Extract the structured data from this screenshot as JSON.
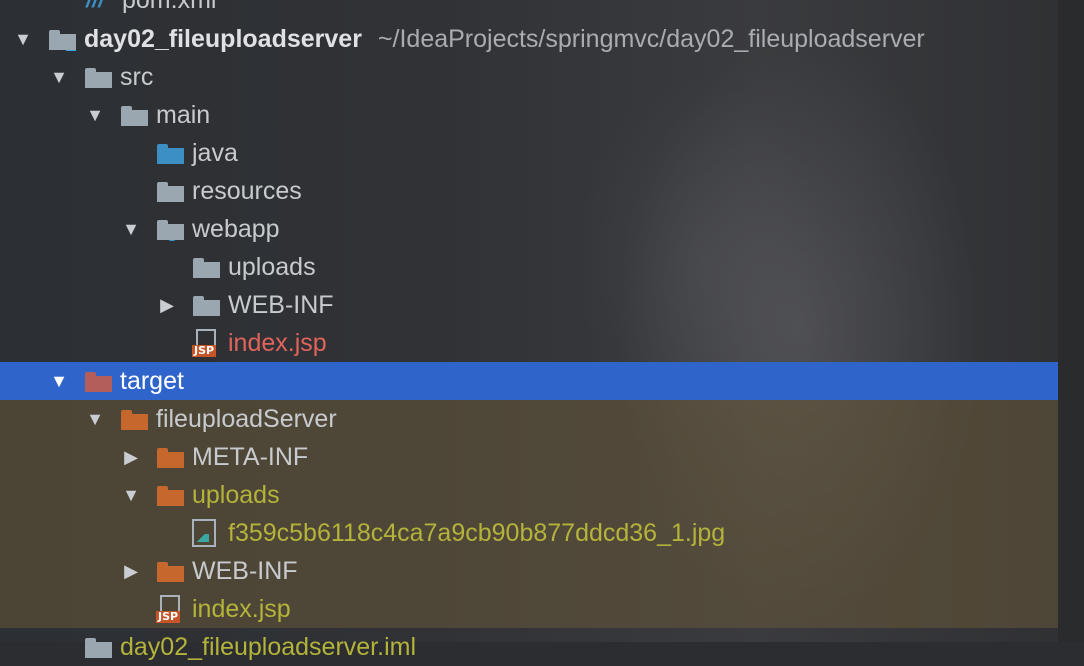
{
  "tree": {
    "rows": [
      {
        "label": "pom.xml",
        "path": "",
        "color": "c-normal"
      },
      {
        "label": "day02_fileuploadserver",
        "path": "~/IdeaProjects/springmvc/day02_fileuploadserver"
      },
      {
        "label": "src"
      },
      {
        "label": "main"
      },
      {
        "label": "java"
      },
      {
        "label": "resources"
      },
      {
        "label": "webapp"
      },
      {
        "label": "uploads"
      },
      {
        "label": "WEB-INF"
      },
      {
        "label": "index.jsp"
      },
      {
        "label": "target"
      },
      {
        "label": "fileuploadServer"
      },
      {
        "label": "META-INF"
      },
      {
        "label": "uploads"
      },
      {
        "label": "f359c5b6118c4ca7a9cb90b877ddcd36_1.jpg"
      },
      {
        "label": "WEB-INF"
      },
      {
        "label": "index.jsp"
      },
      {
        "label": "day02_fileuploadserver.iml"
      }
    ]
  },
  "colors": {
    "selection": "#2f65ca",
    "modified_red": "#e0645b",
    "excluded_olive": "#b4b33a",
    "excluded_folder": "#c6682e"
  },
  "icons": {
    "module": "module-folder-icon",
    "folder": "folder-icon",
    "source_root": "source-root-folder-icon",
    "resources_root": "resources-root-folder-icon",
    "web_root": "web-root-folder-icon",
    "excluded": "excluded-folder-icon",
    "jsp": "jsp-file-icon",
    "image": "image-file-icon",
    "xml": "xml-file-icon"
  }
}
